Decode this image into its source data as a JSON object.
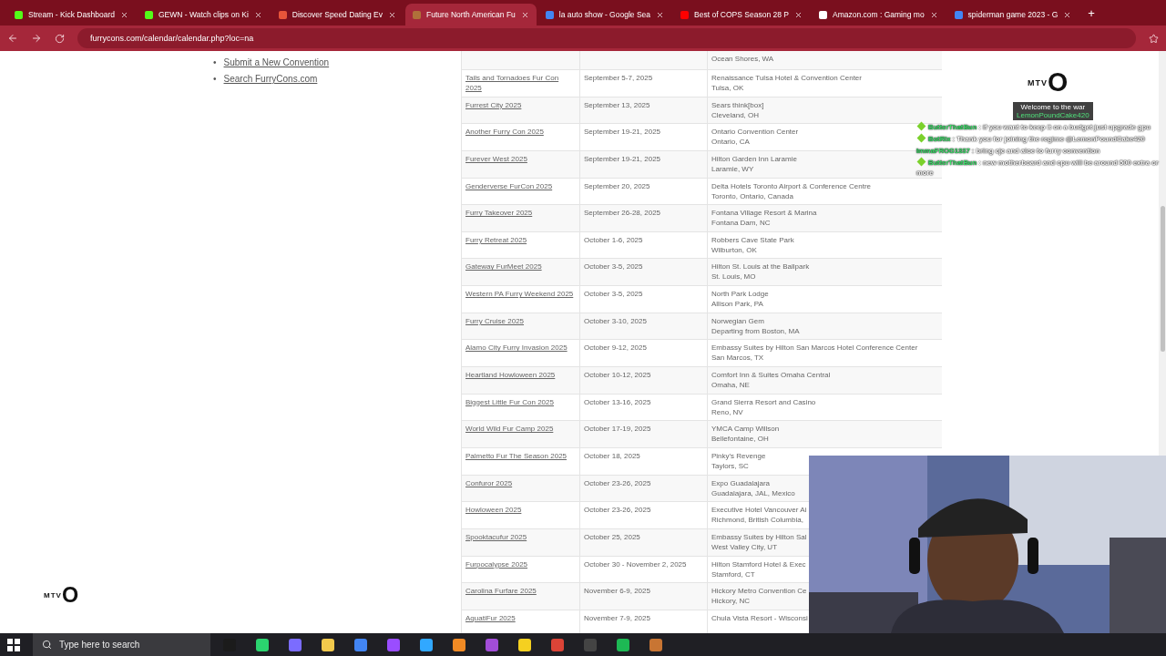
{
  "browser": {
    "tabs": [
      {
        "title": "Stream - Kick Dashboard",
        "selected": false,
        "color": "#53fc18"
      },
      {
        "title": "GEWN - Watch clips on Ki",
        "selected": false,
        "color": "#53fc18"
      },
      {
        "title": "Discover Speed Dating Ev",
        "selected": false,
        "color": "#e8553a"
      },
      {
        "title": "Future North American Fu",
        "selected": true,
        "color": "#b0703a"
      },
      {
        "title": "la auto show - Google Sea",
        "selected": false,
        "color": "#4285f4"
      },
      {
        "title": "Best of COPS Season 28 P",
        "selected": false,
        "color": "#ff0000"
      },
      {
        "title": "Amazon.com : Gaming mo",
        "selected": false,
        "color": "#ffffff"
      },
      {
        "title": "spiderman game 2023 - G",
        "selected": false,
        "color": "#4285f4"
      }
    ],
    "new_tab": "+",
    "address": "furrycons.com/calendar/calendar.php?loc=na"
  },
  "sidebar": {
    "links": [
      {
        "bullet": "•",
        "label": "Submit a New Convention"
      },
      {
        "bullet": "•",
        "label": "Search FurryCons.com"
      }
    ]
  },
  "table": {
    "rows": [
      {
        "city": "Ocean Shores, WA"
      },
      {
        "name": "Tails and Tornadoes Fur Con 2025",
        "date": "September 5-7, 2025",
        "venue": "Renaissance Tulsa Hotel & Convention Center",
        "city": "Tulsa, OK"
      },
      {
        "name": "Furrest City 2025",
        "date": "September 13, 2025",
        "venue": "Sears think[box]",
        "city": "Cleveland, OH"
      },
      {
        "name": "Another Furry Con 2025",
        "date": "September 19-21, 2025",
        "venue": "Ontario Convention Center",
        "city": "Ontario, CA"
      },
      {
        "name": "Furever West 2025",
        "date": "September 19-21, 2025",
        "venue": "Hilton Garden Inn Laramie",
        "city": "Laramie, WY"
      },
      {
        "name": "Genderverse FurCon 2025",
        "date": "September 20, 2025",
        "venue": "Delta Hotels Toronto Airport & Conference Centre",
        "city": "Toronto, Ontario, Canada"
      },
      {
        "name": "Furry Takeover 2025",
        "date": "September 26-28, 2025",
        "venue": "Fontana Village Resort & Marina",
        "city": "Fontana Dam, NC"
      },
      {
        "name": "Furry Retreat 2025",
        "date": "October 1-6, 2025",
        "venue": "Robbers Cave State Park",
        "city": "Wilburton, OK"
      },
      {
        "name": "Gateway FurMeet 2025",
        "date": "October 3-5, 2025",
        "venue": "Hilton St. Louis at the Ballpark",
        "city": "St. Louis, MO"
      },
      {
        "name": "Western PA Furry Weekend 2025",
        "date": "October 3-5, 2025",
        "venue": "North Park Lodge",
        "city": "Allison Park, PA"
      },
      {
        "name": "Furry Cruise 2025",
        "date": "October 3-10, 2025",
        "venue": "Norwegian Gem",
        "city": "Departing from Boston, MA"
      },
      {
        "name": "Alamo City Furry Invasion 2025",
        "date": "October 9-12, 2025",
        "venue": "Embassy Suites by Hilton San Marcos Hotel Conference Center",
        "city": "San Marcos, TX"
      },
      {
        "name": "Heartland Howloween 2025",
        "date": "October 10-12, 2025",
        "venue": "Comfort Inn & Suites Omaha Central",
        "city": "Omaha, NE"
      },
      {
        "name": "Biggest Little Fur Con 2025",
        "date": "October 13-16, 2025",
        "venue": "Grand Sierra Resort and Casino",
        "city": "Reno, NV"
      },
      {
        "name": "World Wild Fur Camp 2025",
        "date": "October 17-19, 2025",
        "venue": "YMCA Camp Willson",
        "city": "Bellefontaine, OH"
      },
      {
        "name": "Palmetto Fur The Season 2025",
        "date": "October 18, 2025",
        "venue": "Pinky's Revenge",
        "city": "Taylors, SC"
      },
      {
        "name": "Confuror 2025",
        "date": "October 23-26, 2025",
        "venue": "Expo Guadalajara",
        "city": "Guadalajara, JAL, Mexico"
      },
      {
        "name": "Howloween 2025",
        "date": "October 23-26, 2025",
        "venue": "Executive Hotel Vancouver Ai",
        "city": "Richmond, British Columbia,"
      },
      {
        "name": "Spooktacufur 2025",
        "date": "October 25, 2025",
        "venue": "Embassy Suites by Hilton Sal",
        "city": "West Valley City, UT"
      },
      {
        "name": "Furpocalypse 2025",
        "date": "October 30 - November 2, 2025",
        "venue": "Hilton Stamford Hotel & Exec",
        "city": "Stamford, CT"
      },
      {
        "name": "Carolina Furfare 2025",
        "date": "November 6-9, 2025",
        "venue": "Hickory Metro Convention Ce",
        "city": "Hickory, NC"
      },
      {
        "name": "AquatiFur 2025",
        "date": "November 7-9, 2025",
        "venue": "Chula Vista Resort - Wisconsi"
      }
    ]
  },
  "overlay": {
    "logo": {
      "letters": "MTV",
      "mark": "O"
    },
    "welcome": "Welcome to the war",
    "welcome_user": "LemonPoundCake420",
    "chat": [
      {
        "user": "ButterThatBun",
        "text": ": if you want to keep it on a budget just upgrade gpu",
        "badge": true
      },
      {
        "user": "BotRix",
        "text": ": Thank you for joining the regime @LemonPoundCake420",
        "badge": true
      },
      {
        "user": "ImmaFROG1337",
        "text": ": bring cjc and aloe to furry convention",
        "badge": false
      },
      {
        "user": "ButterThatBun",
        "text": ": new motherboard and cpu will be around 500 extra or more",
        "badge": true
      }
    ],
    "corner_logo": {
      "letters": "MTV",
      "mark": "O"
    }
  },
  "taskbar": {
    "search": "Type here to search",
    "apps": [
      {
        "color": "#1b1b1b"
      },
      {
        "color": "#2bd46f"
      },
      {
        "color": "#7b6cff"
      },
      {
        "color": "#f2c94c"
      },
      {
        "color": "#4285f4"
      },
      {
        "color": "#9a4dff"
      },
      {
        "color": "#31a8ff"
      },
      {
        "color": "#f08a24"
      },
      {
        "color": "#a24dd8"
      },
      {
        "color": "#f5d020"
      },
      {
        "color": "#db4437"
      },
      {
        "color": "#444444"
      },
      {
        "color": "#1db954"
      },
      {
        "color": "#c87533"
      }
    ]
  }
}
